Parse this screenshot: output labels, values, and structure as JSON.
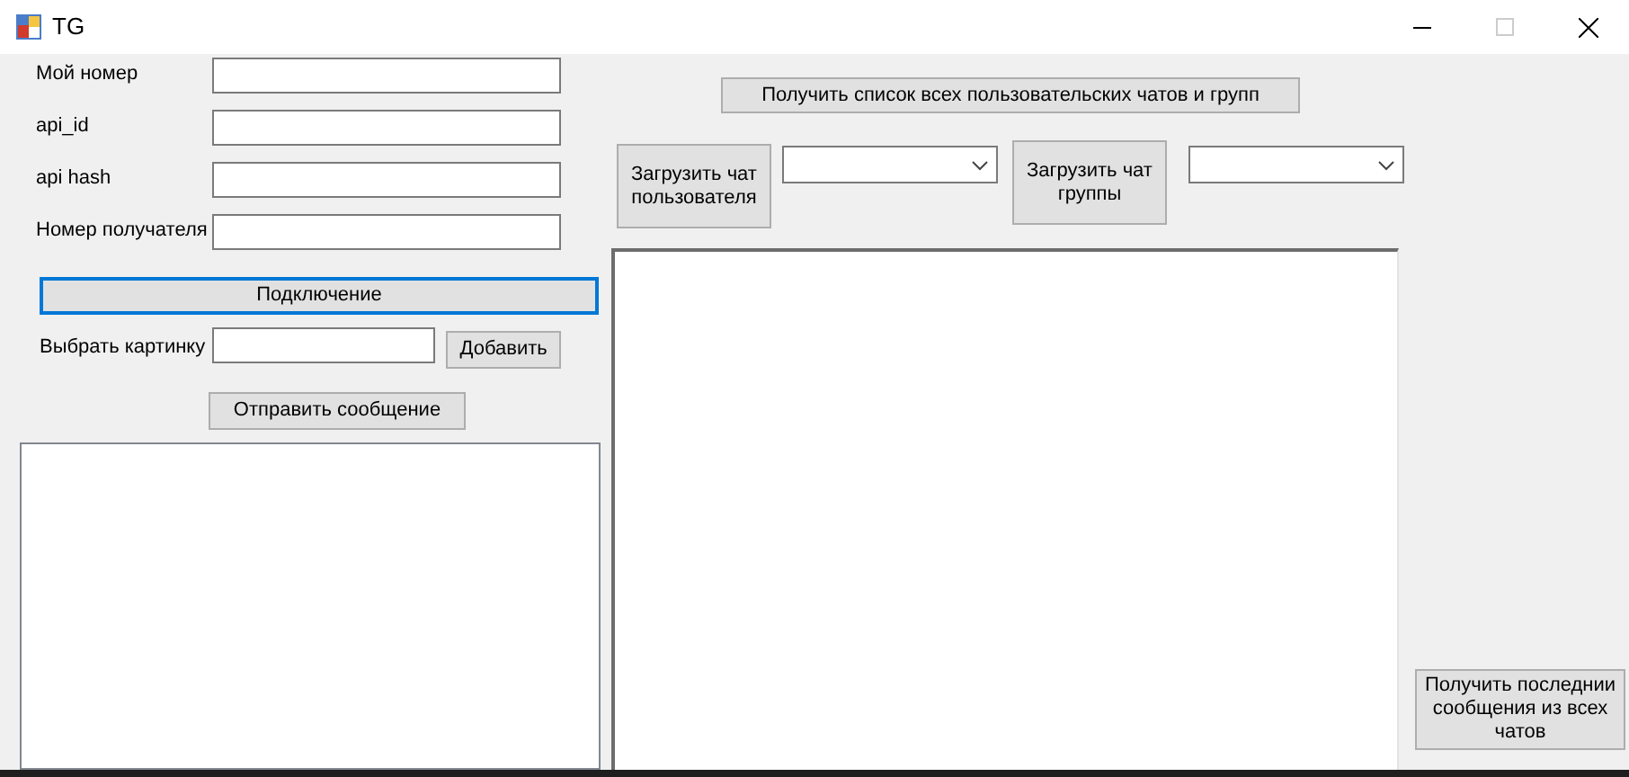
{
  "window": {
    "title": "TG"
  },
  "fields": [
    {
      "label": "Мой номер"
    },
    {
      "label": "api_id"
    },
    {
      "label": "api hash"
    },
    {
      "label": "Номер получателя"
    }
  ],
  "connect_button": {
    "label": "Подключение",
    "focused": true
  },
  "image_picker": {
    "label": "Выбрать картинку",
    "button": "Добавить"
  },
  "send_button": "Отправить сообщение",
  "get_chats_button": "Получить список всех пользовательских чатов и групп",
  "user_chat_button": "Загрузить чат пользователя",
  "group_chat_button": "Загрузить чат группы",
  "last_messages_button": "Получить последнии сообщения из всех чатов"
}
